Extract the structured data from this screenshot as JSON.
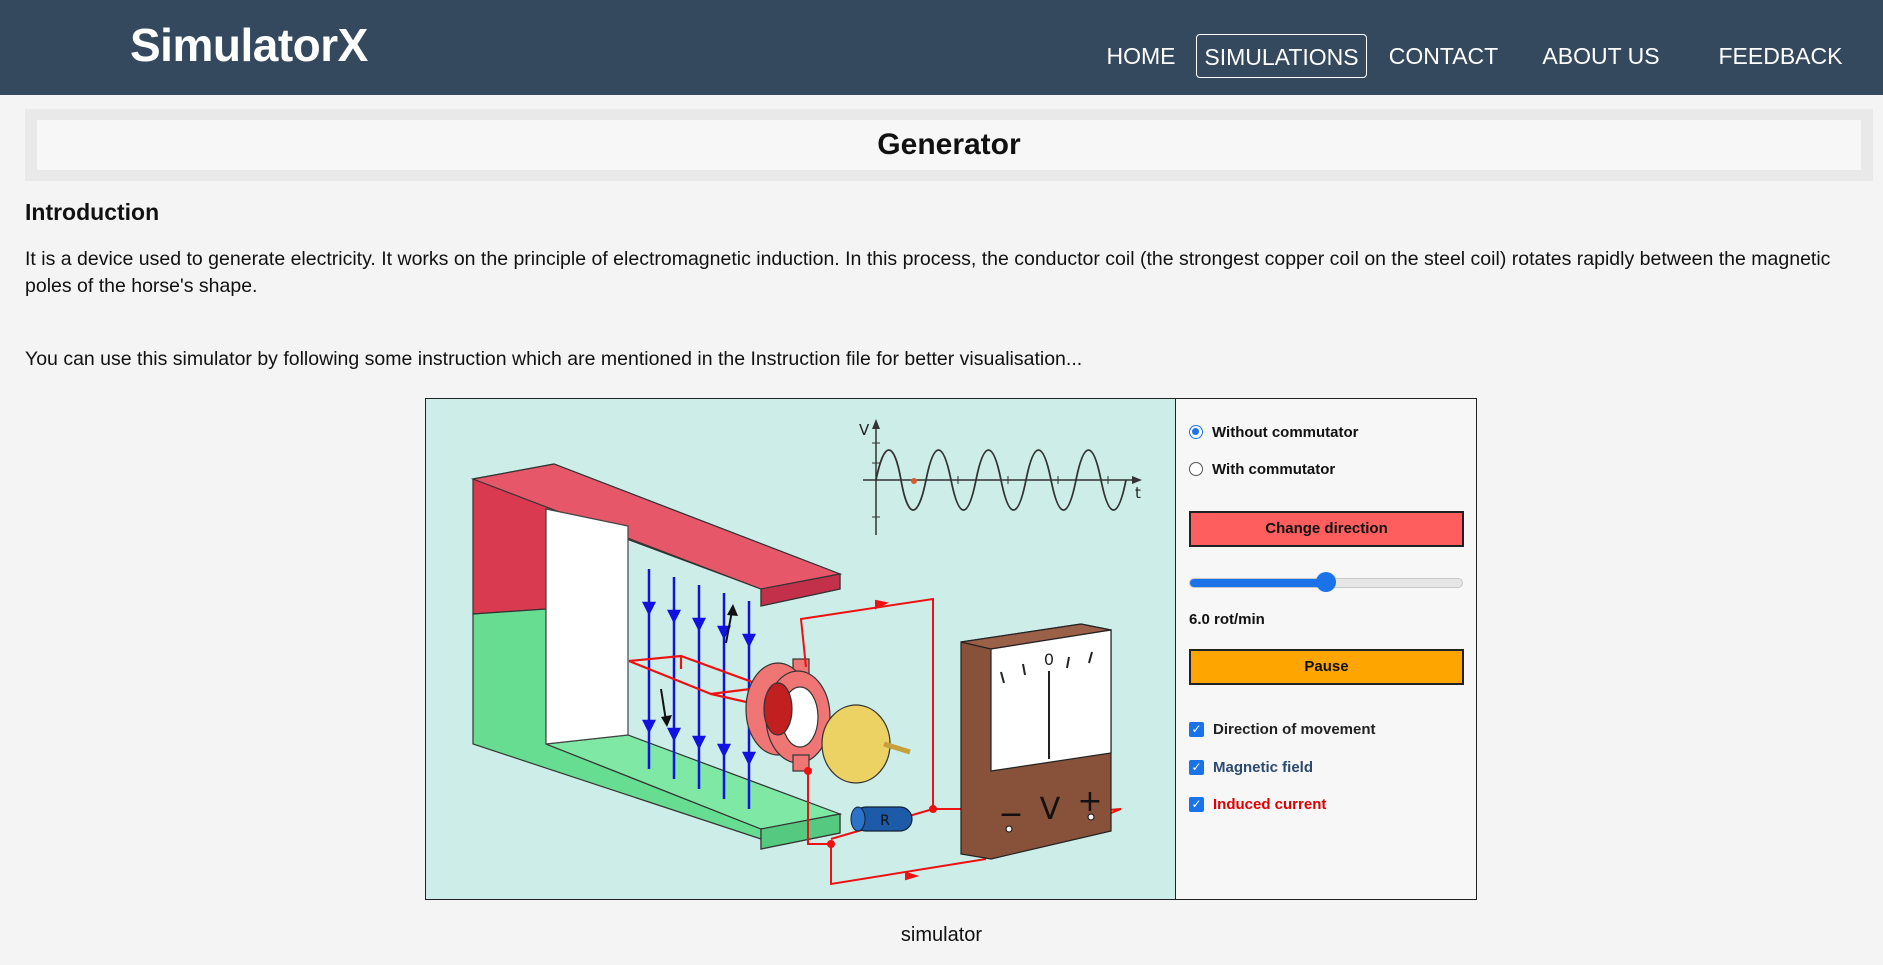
{
  "header": {
    "brand": "SimulatorX",
    "nav": [
      {
        "label": "HOME",
        "active": false
      },
      {
        "label": "SIMULATIONS",
        "active": true
      },
      {
        "label": "CONTACT",
        "active": false
      },
      {
        "label": "ABOUT US",
        "active": false
      },
      {
        "label": "FEEDBACK",
        "active": false
      }
    ]
  },
  "page": {
    "title": "Generator",
    "intro_heading": "Introduction",
    "paragraph_1": "It is a device used to generate electricity. It works on the principle of electromagnetic induction. In this process, the conductor coil (the strongest copper coil on the steel coil) rotates rapidly between the magnetic poles of the horse's shape.",
    "paragraph_2": "You can use this simulator by following some instruction which are mentioned in the Instruction file for better visualisation...",
    "caption": "simulator"
  },
  "simulator": {
    "graph": {
      "y_label": "V",
      "x_label": "t"
    },
    "meter": {
      "zero_label": "0",
      "minus_label": "−",
      "v_label": "V",
      "plus_label": "+"
    },
    "resistor_label": "R",
    "modes": [
      {
        "label": "Without commutator",
        "selected": true
      },
      {
        "label": "With commutator",
        "selected": false
      }
    ],
    "change_direction_label": "Change direction",
    "speed": {
      "value": 6.0,
      "min": 0,
      "max": 12,
      "label": "6.0 rot/min"
    },
    "pause_label": "Pause",
    "toggles": [
      {
        "label": "Direction of movement",
        "checked": true,
        "color": "#222222"
      },
      {
        "label": "Magnetic field",
        "checked": true,
        "color": "#2c4a6e"
      },
      {
        "label": "Induced current",
        "checked": true,
        "color": "#e00000"
      }
    ],
    "colors": {
      "change_direction_bg": "#ff5e5e",
      "pause_bg": "#ffa500",
      "magnet_north": "#d93a50",
      "magnet_south": "#66dd90",
      "field_lines": "#1212e0",
      "current_wire": "#ee1111",
      "meter_body": "#87513a"
    }
  }
}
